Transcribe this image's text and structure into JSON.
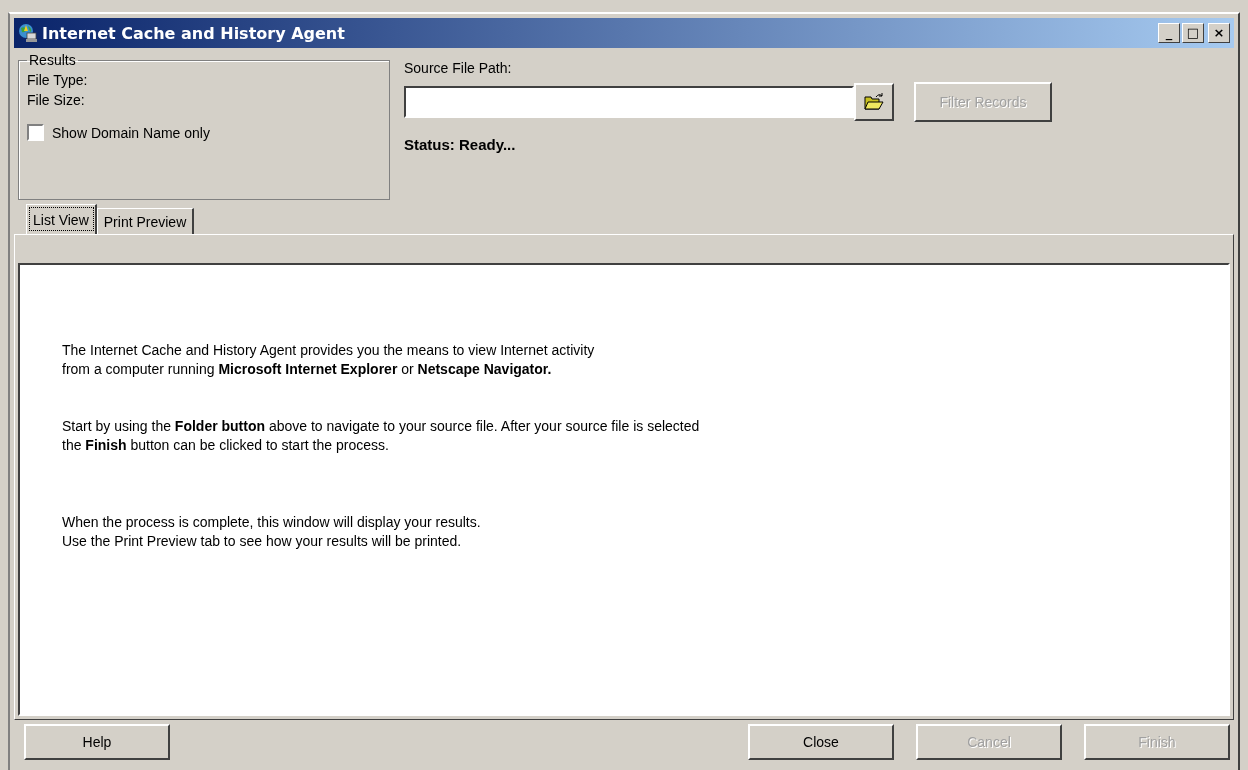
{
  "window": {
    "title": "Internet Cache and History Agent",
    "controls": [
      "_",
      "□",
      "×"
    ]
  },
  "results": {
    "legend": "Results",
    "fields": [
      "File Type:",
      "File Size:"
    ],
    "checkbox": {
      "label": "Show Domain Name only",
      "checked": false
    }
  },
  "source": {
    "label": "Source File Path:",
    "filter_button": {
      "label": "Filter Records",
      "disabled": true
    },
    "status": "Status: Ready..."
  },
  "tabs": [
    {
      "label": "List View",
      "selected": true
    },
    {
      "label": "Print Preview",
      "selected": false
    }
  ],
  "paragraphs": [
    {
      "lines": [
        "The Internet Cache and History Agent provides you the means to view Internet activity",
        "from a computer running **Microsoft Internet Explorer** or **Netscape Navigator.**"
      ]
    },
    {
      "lines": [
        "Start by using the **Folder button** above to navigate to your source file.  After your source file is selected",
        "the **Finish** button can be clicked to start the process."
      ]
    },
    {
      "lines": [
        "When the process is complete, this window will display your results.",
        "Use the Print Preview tab to see how your results will be printed."
      ]
    }
  ],
  "left_buttons": [
    {
      "label": "Help",
      "disabled": false
    }
  ],
  "right_buttons": [
    {
      "label": "Close",
      "disabled": false
    },
    {
      "label": "Cancel",
      "disabled": true
    },
    {
      "label": "Finish",
      "disabled": true
    }
  ]
}
